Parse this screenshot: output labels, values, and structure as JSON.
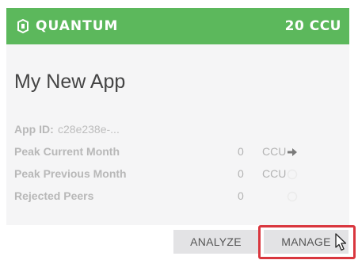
{
  "header": {
    "brand": "QUANTUM",
    "plan": "20 CCU",
    "brand_icon": "shield-badge-icon",
    "background_color": "#5cb85c"
  },
  "app": {
    "name": "My New App",
    "id_label": "App ID:",
    "id_value": "c28e238e-..."
  },
  "stats": [
    {
      "label": "Peak Current Month",
      "value": "0",
      "unit": "CCU",
      "icon": "arrow-right-icon"
    },
    {
      "label": "Peak Previous Month",
      "value": "0",
      "unit": "CCU",
      "icon": "circle-icon"
    },
    {
      "label": "Rejected Peers",
      "value": "0",
      "unit": "",
      "icon": "circle-icon"
    }
  ],
  "actions": {
    "analyze_label": "ANALYZE",
    "manage_label": "MANAGE"
  },
  "annotation": {
    "highlight_color": "#d9363e",
    "cursor_icon": "mouse-pointer-icon"
  }
}
